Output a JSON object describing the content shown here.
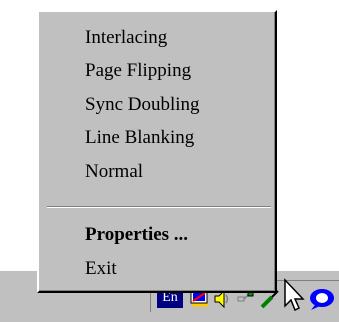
{
  "menu": {
    "items": [
      {
        "label": "Interlacing",
        "bold": false
      },
      {
        "label": "Page Flipping",
        "bold": false
      },
      {
        "label": "Sync Doubling",
        "bold": false
      },
      {
        "label": "Line Blanking",
        "bold": false
      },
      {
        "label": "Normal",
        "bold": false
      },
      {
        "label": "Properties ...",
        "bold": true
      },
      {
        "label": "Exit",
        "bold": false
      }
    ]
  },
  "tray": {
    "language_label": "En",
    "icons": [
      "display-settings-icon",
      "speaker-icon",
      "network-icon",
      "help-balloon-icon"
    ]
  },
  "colors": {
    "menu_background": "#c0c0c0",
    "language_badge": "#000080",
    "highlight_blue": "#0000ff"
  }
}
